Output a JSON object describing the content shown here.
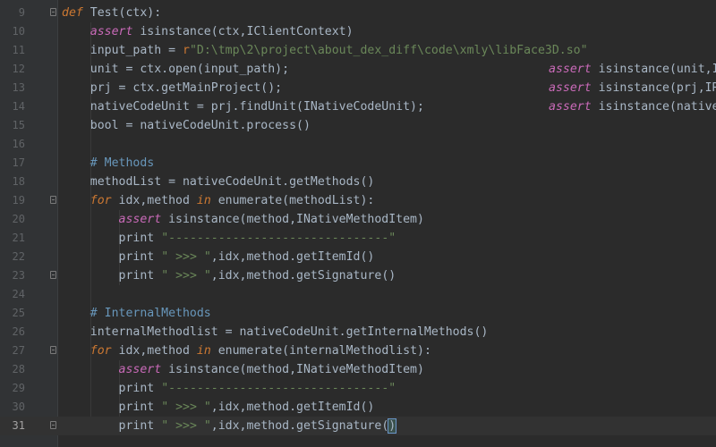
{
  "editor": {
    "lines": [
      {
        "n": "9",
        "t": "def Test(ctx):"
      },
      {
        "n": "10",
        "t": "    assert isinstance(ctx,IClientContext)"
      },
      {
        "n": "11",
        "t": "    input_path = r\"D:\\tmp\\2\\project\\about_dex_diff\\code\\xmly\\libFace3D.so\""
      },
      {
        "n": "12",
        "t": "    unit = ctx.open(input_path);",
        "t2": "assert isinstance(unit,I"
      },
      {
        "n": "13",
        "t": "    prj = ctx.getMainProject();",
        "t2": "assert isinstance(prj,IR"
      },
      {
        "n": "14",
        "t": "    nativeCodeUnit = prj.findUnit(INativeCodeUnit);",
        "t2": "assert isinstance(native"
      },
      {
        "n": "15",
        "t": "    bool = nativeCodeUnit.process()"
      },
      {
        "n": "16",
        "t": ""
      },
      {
        "n": "17",
        "t": "    # Methods"
      },
      {
        "n": "18",
        "t": "    methodList = nativeCodeUnit.getMethods()"
      },
      {
        "n": "19",
        "t": "    for idx,method in enumerate(methodList):"
      },
      {
        "n": "20",
        "t": "        assert isinstance(method,INativeMethodItem)"
      },
      {
        "n": "21",
        "t": "        print \"-------------------------------\""
      },
      {
        "n": "22",
        "t": "        print \" >>> \",idx,method.getItemId()"
      },
      {
        "n": "23",
        "t": "        print \" >>> \",idx,method.getSignature()"
      },
      {
        "n": "24",
        "t": ""
      },
      {
        "n": "25",
        "t": "    # InternalMethods"
      },
      {
        "n": "26",
        "t": "    internalMethodlist = nativeCodeUnit.getInternalMethods()"
      },
      {
        "n": "27",
        "t": "    for idx,method in enumerate(internalMethodlist):"
      },
      {
        "n": "28",
        "t": "        assert isinstance(method,INativeMethodItem)"
      },
      {
        "n": "29",
        "t": "        print \"-------------------------------\""
      },
      {
        "n": "30",
        "t": "        print \" >>> \",idx,method.getItemId()"
      },
      {
        "n": "31",
        "t": "        print \" >>> \",idx,method.getSignature()"
      }
    ]
  }
}
